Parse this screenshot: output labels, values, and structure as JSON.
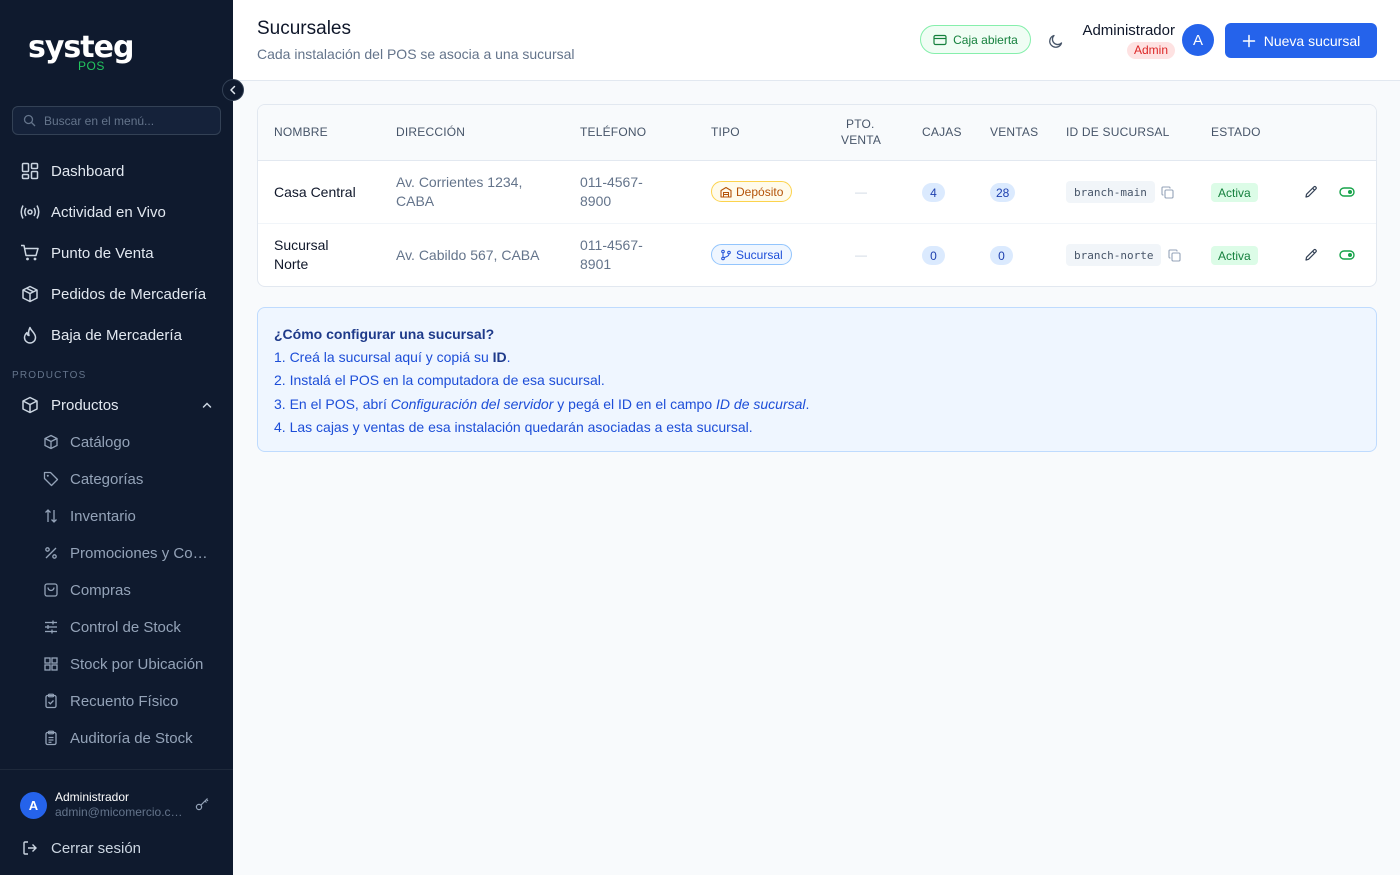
{
  "sidebar": {
    "logo_main": "systeg",
    "logo_sub": "POS",
    "search_placeholder": "Buscar en el menú...",
    "nav": [
      {
        "label": "Dashboard",
        "icon": "dashboard-icon"
      },
      {
        "label": "Actividad en Vivo",
        "icon": "live-activity-icon"
      },
      {
        "label": "Punto de Venta",
        "icon": "cart-icon"
      },
      {
        "label": "Pedidos de Mercadería",
        "icon": "package-icon"
      },
      {
        "label": "Baja de Mercadería",
        "icon": "flame-icon"
      }
    ],
    "section_label": "PRODUCTOS",
    "group": {
      "label": "Productos",
      "icon": "box-icon",
      "expanded": true
    },
    "sub_items": [
      {
        "label": "Catálogo",
        "icon": "catalog-icon"
      },
      {
        "label": "Categorías",
        "icon": "tag-icon"
      },
      {
        "label": "Inventario",
        "icon": "sort-arrows-icon"
      },
      {
        "label": "Promociones y Combos",
        "icon": "percent-icon"
      },
      {
        "label": "Compras",
        "icon": "shopping-bag-icon"
      },
      {
        "label": "Control de Stock",
        "icon": "sliders-icon"
      },
      {
        "label": "Stock por Ubicación",
        "icon": "grid-icon"
      },
      {
        "label": "Recuento Físico",
        "icon": "clipboard-check-icon"
      },
      {
        "label": "Auditoría de Stock",
        "icon": "clipboard-list-icon"
      }
    ],
    "footer": {
      "user_initial": "A",
      "user_name": "Administrador",
      "user_email": "admin@micomercio.com",
      "logout_label": "Cerrar sesión"
    }
  },
  "header": {
    "title": "Sucursales",
    "subtitle": "Cada instalación del POS se asocia a una sucursal",
    "caja_status": "Caja abierta",
    "admin_name": "Administrador",
    "admin_role": "Admin",
    "avatar_initial": "A",
    "new_button": "Nueva sucursal"
  },
  "table": {
    "columns": [
      "NOMBRE",
      "DIRECCIÓN",
      "TELÉFONO",
      "TIPO",
      "PTO.",
      "VENTA",
      "CAJAS",
      "VENTAS",
      "ID DE SUCURSAL",
      "ESTADO"
    ],
    "rows": [
      {
        "name": "Casa Central",
        "address_1": "Av. Corrientes 1234,",
        "address_2": "CABA",
        "phone_1": "011-4567-",
        "phone_2": "8900",
        "type": "Depósito",
        "pto_venta": "—",
        "cajas": "4",
        "ventas": "28",
        "branch_id": "branch-main",
        "status": "Activa"
      },
      {
        "name_1": "Sucursal",
        "name_2": "Norte",
        "address": "Av. Cabildo 567, CABA",
        "phone_1": "011-4567-",
        "phone_2": "8901",
        "type": "Sucursal",
        "pto_venta": "—",
        "cajas": "0",
        "ventas": "0",
        "branch_id": "branch-norte",
        "status": "Activa"
      }
    ]
  },
  "info": {
    "title": "¿Cómo configurar una sucursal?",
    "line1_a": "1. Creá la sucursal aquí y copiá su ",
    "line1_b": "ID",
    "line1_c": ".",
    "line2": "2. Instalá el POS en la computadora de esa sucursal.",
    "line3_a": "3. En el POS, abrí ",
    "line3_b": "Configuración del servidor",
    "line3_c": " y pegá el ID en el campo ",
    "line3_d": "ID de sucursal",
    "line3_e": ".",
    "line4": "4. Las cajas y ventas de esa instalación quedarán asociadas a esta sucursal."
  },
  "colors": {
    "sidebar_bg": "#0f1a2e",
    "accent": "#2563eb",
    "success": "#15803d",
    "warning": "#b45309"
  }
}
